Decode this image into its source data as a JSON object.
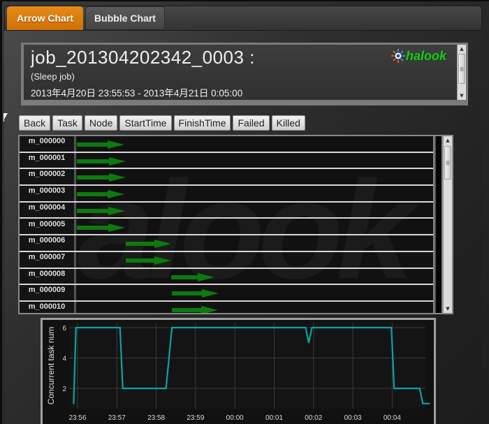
{
  "tabs": [
    {
      "label": "Arrow Chart",
      "active": true
    },
    {
      "label": "Bubble Chart",
      "active": false
    }
  ],
  "header": {
    "title": "job_201304202342_0003 :",
    "subtitle": "(Sleep job)",
    "time_range": "2013年4月20日 23:55:53 - 2013年4月21日 0:05:00",
    "logo_text": "halook"
  },
  "toolbar": {
    "buttons": [
      "Back",
      "Task",
      "Node",
      "StartTime",
      "FinishTime",
      "Failed",
      "Killed"
    ]
  },
  "tasks": {
    "watermark": "halook",
    "rows": [
      {
        "id": "m_000000",
        "start": 0.0,
        "end": 1.2
      },
      {
        "id": "m_000001",
        "start": 0.0,
        "end": 1.25
      },
      {
        "id": "m_000002",
        "start": 0.0,
        "end": 1.25
      },
      {
        "id": "m_000003",
        "start": 0.0,
        "end": 1.2
      },
      {
        "id": "m_000004",
        "start": 0.0,
        "end": 1.22
      },
      {
        "id": "m_000005",
        "start": 0.0,
        "end": 1.22
      },
      {
        "id": "m_000006",
        "start": 1.25,
        "end": 2.4
      },
      {
        "id": "m_000007",
        "start": 1.25,
        "end": 2.4
      },
      {
        "id": "m_000008",
        "start": 2.4,
        "end": 3.5
      },
      {
        "id": "m_000009",
        "start": 2.42,
        "end": 3.6
      },
      {
        "id": "m_000010",
        "start": 2.42,
        "end": 3.58
      }
    ]
  },
  "colors": {
    "accent_tab": "#e07f10",
    "arrow": "#0d7a0d",
    "line": "#0aa3a3",
    "logo": "#22c522"
  },
  "chart_data": {
    "type": "line",
    "title": "",
    "xlabel": "",
    "ylabel": "Concurrent task num",
    "x_unit": "minutes after 23:56",
    "xticks": [
      "23:56",
      "23:57",
      "23:58",
      "23:59",
      "00:00",
      "00:01",
      "00:02",
      "00:03",
      "00:04"
    ],
    "yticks": [
      2,
      4,
      6
    ],
    "ylim": [
      0.6,
      6.3
    ],
    "xlim": [
      -0.12,
      9.05
    ],
    "grid": true,
    "series": [
      {
        "name": "Concurrent task num",
        "x": [
          -0.1,
          -0.04,
          1.08,
          1.15,
          2.25,
          2.4,
          5.8,
          5.88,
          5.96,
          7.98,
          8.05,
          8.7,
          8.78,
          8.95
        ],
        "y": [
          1,
          6,
          6,
          2,
          2,
          6,
          6,
          5,
          6,
          6,
          2,
          2,
          1,
          1
        ]
      }
    ]
  }
}
